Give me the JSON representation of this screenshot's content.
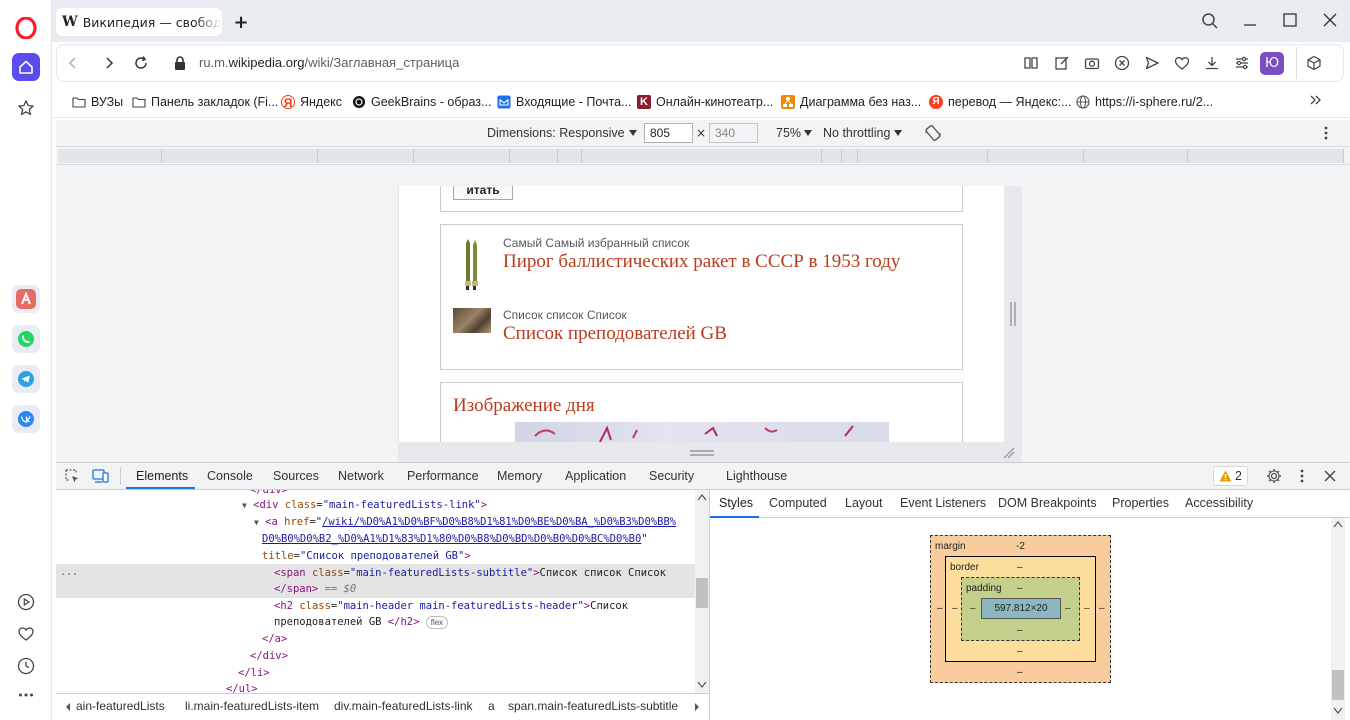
{
  "browser": {
    "tab_title": "Википедия — свободная",
    "tab_add": "+",
    "url_prefix": "ru.m.",
    "url_domain": "wikipedia.org",
    "url_path": "/wiki/Заглавная_страница",
    "profile_initial": "Ю"
  },
  "bookmarks": [
    {
      "label": "ВУЗы",
      "icon": "folder-icon"
    },
    {
      "label": "Панель закладок (Fi...",
      "icon": "folder-icon"
    },
    {
      "label": "Яндекс",
      "icon": "yandex-icon"
    },
    {
      "label": "GeekBrains - образ...",
      "icon": "geekbrains-icon"
    },
    {
      "label": "Входящие - Почта...",
      "icon": "mail-icon"
    },
    {
      "label": "Онлайн-кинотеатр...",
      "icon": "kinopoisk-icon"
    },
    {
      "label": "Диаграмма без наз...",
      "icon": "diagram-icon"
    },
    {
      "label": "перевод — Яндекс:...",
      "icon": "yandex-icon"
    },
    {
      "label": "https://i-sphere.ru/2...",
      "icon": "globe-icon"
    }
  ],
  "device_toolbar": {
    "dimensions_label": "Dimensions: Responsive",
    "width": "805",
    "times": "×",
    "height": "340",
    "zoom": "75%",
    "throttling": "No throttling"
  },
  "wiki": {
    "button_partial": "итать",
    "featured": [
      {
        "subtitle": "Самый Самый избранный список",
        "header": "Пирог баллистических ракет в СССР в 1953 году"
      },
      {
        "subtitle": "Список список Список",
        "header": "Список преподователей GB"
      }
    ],
    "image_of_day": "Изображение дня"
  },
  "devtools": {
    "tabs": [
      "Elements",
      "Console",
      "Sources",
      "Network",
      "Performance",
      "Memory",
      "Application",
      "Security",
      "Lighthouse"
    ],
    "active_tab": "Elements",
    "warnings_count": "2",
    "code_lines": {
      "l0": "</div>",
      "l1_tag": "div",
      "l1_attr": "class",
      "l1_val": "\"main-featuredLists-link\"",
      "l2_tag": "a",
      "l2_attr": "href",
      "l2_href1": "/wiki/%D0%A1%D0%BF%D0%B8%D1%81%D0%BE%D0%BA_%D0%B3%D0%BB%",
      "l2_href2": "D0%B0%D0%B2_%D0%A1%D1%83%D1%80%D0%B8%D0%BD%D0%B0%D0%BC%D0%B0",
      "l2_title_attr": "title",
      "l2_title_val": "\"Список преподователей GB\"",
      "l3_tag": "span",
      "l3_attr": "class",
      "l3_val": "\"main-featuredLists-subtitle\"",
      "l3_text": "Список список Список",
      "l4_close": "</span>",
      "l4_eq": " == $0",
      "l5_tag": "h2",
      "l5_attr": "class",
      "l5_val": "\"main-header main-featuredLists-header\"",
      "l5_text": "Список",
      "l6_text": "преподователей GB ",
      "l6_close": "</h2>",
      "flex_badge": "flex",
      "l7": "</a>",
      "l8": "</div>",
      "l9": "</li>",
      "l10": "</ul>",
      "ellipsis": "..."
    },
    "breadcrumbs": [
      "ain-featuredLists",
      "li.main-featuredLists-item",
      "div.main-featuredLists-link",
      "a",
      "span.main-featuredLists-subtitle"
    ],
    "subtabs": [
      "Styles",
      "Computed",
      "Layout",
      "Event Listeners",
      "DOM Breakpoints",
      "Properties",
      "Accessibility"
    ],
    "active_subtab": "Styles",
    "box_model": {
      "margin_label": "margin",
      "margin_top": "-2",
      "margin_bottom": "–",
      "margin_left": "–",
      "margin_right": "–",
      "border_label": "border",
      "border_top": "–",
      "border_bottom": "–",
      "border_left": "–",
      "border_right": "–",
      "padding_label": "padding",
      "padding_top": "–",
      "padding_bottom": "–",
      "padding_left": "–",
      "padding_right": "–",
      "content": "597.812×20"
    }
  },
  "colors": {
    "opera_red": "#ff1b2d",
    "opera_accent": "#5b4cf0",
    "wiki_header": "#ba3a1b",
    "box_margin": "#f9cc9d",
    "box_border": "#fddd9b",
    "box_padding": "#c3d08b",
    "box_content": "#8cb6c0"
  }
}
